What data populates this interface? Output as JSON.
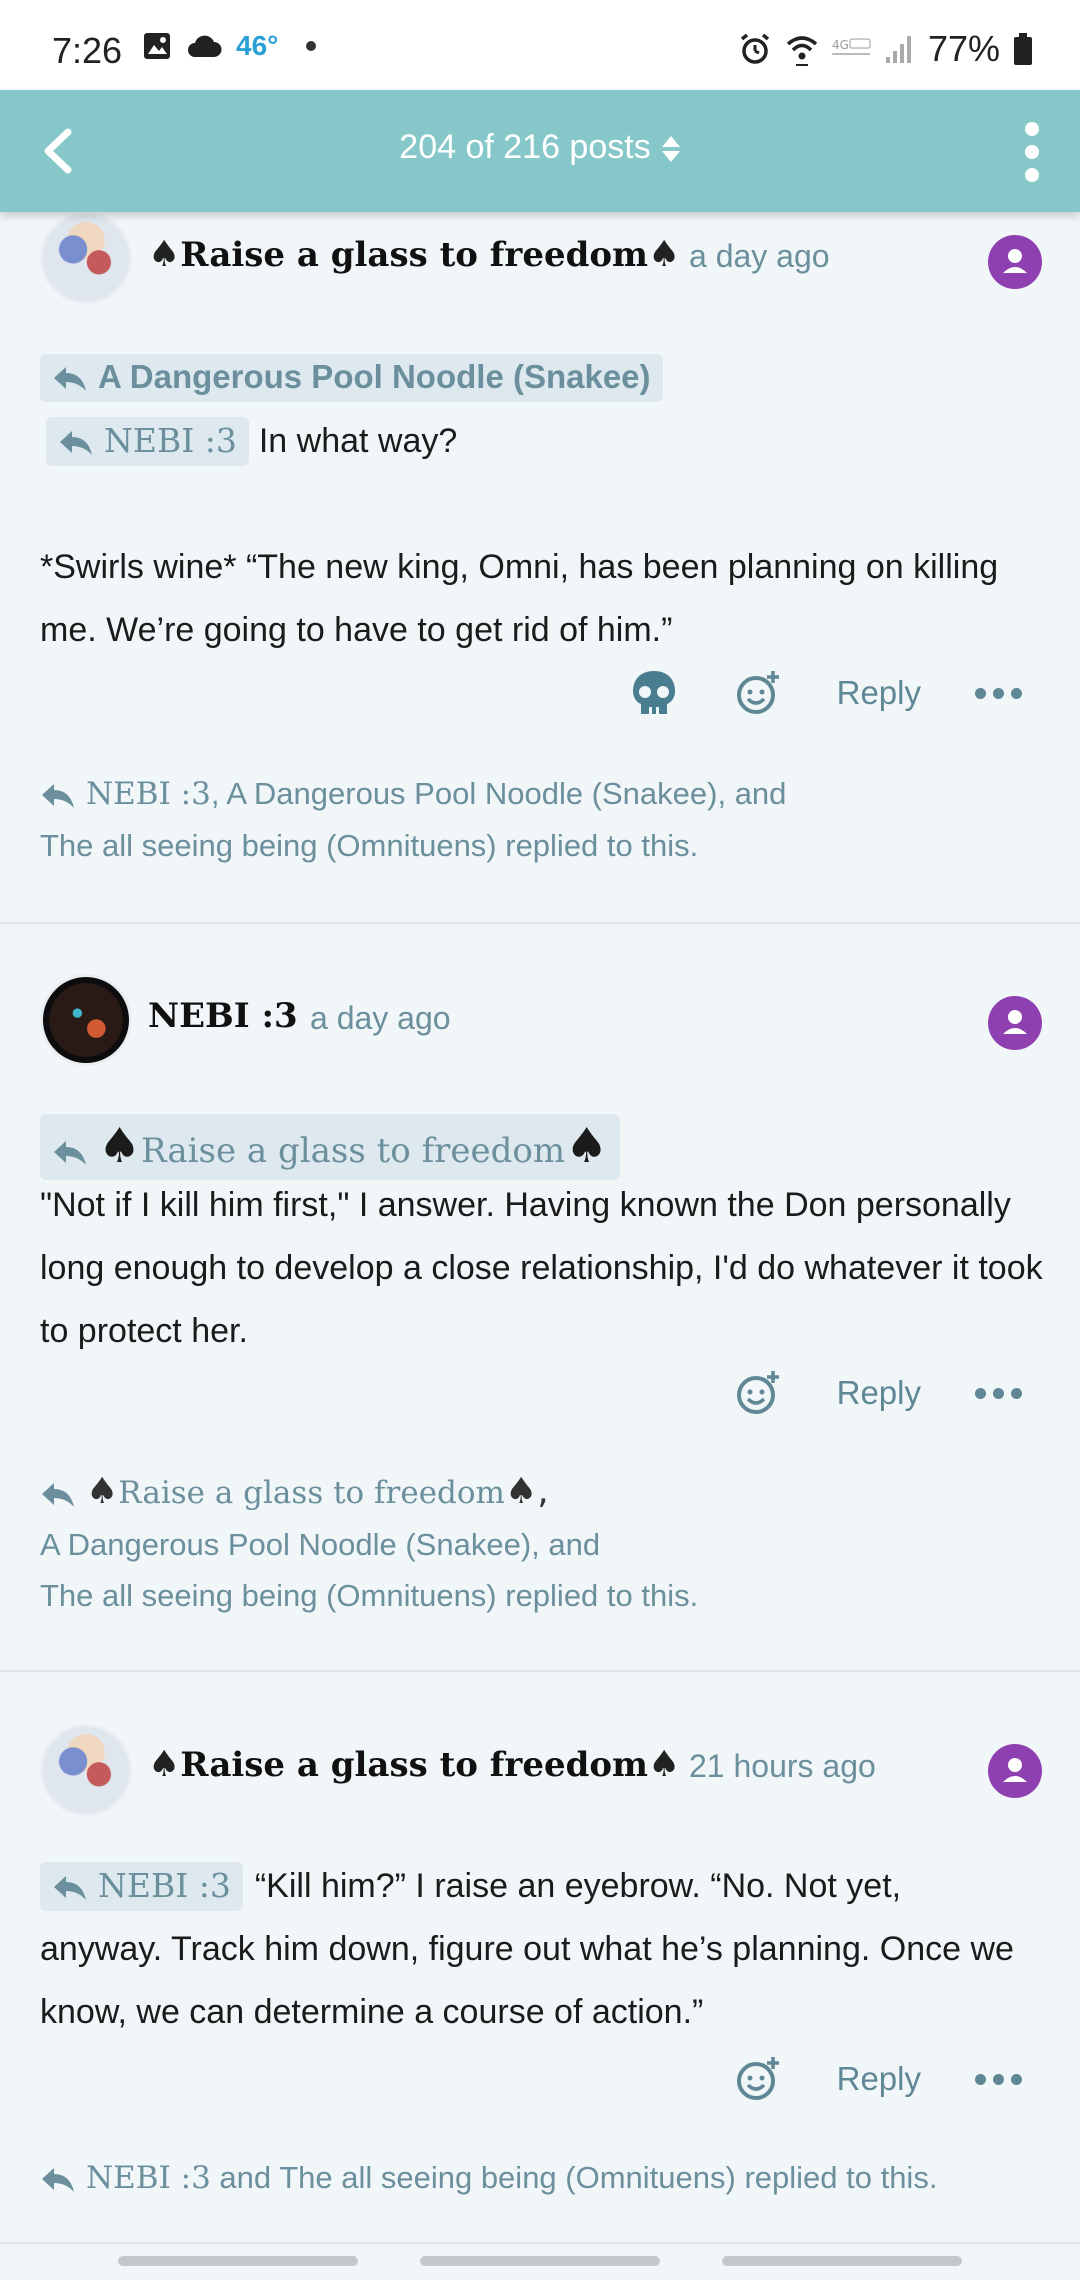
{
  "status_bar": {
    "time": "7:26",
    "temperature": "46°",
    "battery_percent": "77%"
  },
  "header": {
    "title": "204 of 216 posts"
  },
  "posts": [
    {
      "author": "Raise a glass to freedom",
      "author_prefix": "♠",
      "author_suffix": "♠",
      "time": "a day ago",
      "reply_to_1": "A Dangerous Pool Noodle (Snakee)",
      "reply_to_2": "NEBI :3",
      "line1": "In what way?",
      "body": "*Swirls wine* “The new king, Omni, has been planning on killing me. We’re going to have to get rid of him.”",
      "reply_label": "Reply",
      "replied_names_1": "NEBI :3",
      "replied_names_2": ", A Dangerous Pool Noodle (Snakee), and",
      "replied_names_3": "The all seeing being (Omnituens) replied to this."
    },
    {
      "author": "NEBI :3",
      "time": "a day ago",
      "reply_to_prefix": "♠",
      "reply_to": "Raise a glass to freedom",
      "reply_to_suffix": "♠",
      "body": "\"Not if I kill him first,\" I answer. Having known the Don personally long enough to develop a close relationship, I'd do whatever it took to protect her.",
      "reply_label": "Reply",
      "replied_names_1_prefix": "♠",
      "replied_names_1": "Raise a glass to freedom",
      "replied_names_1_suffix": "♠,",
      "replied_names_2": "A Dangerous Pool Noodle (Snakee), and",
      "replied_names_3": "The all seeing being (Omnituens) replied to this."
    },
    {
      "author": "Raise a glass to freedom",
      "author_prefix": "♠",
      "author_suffix": "♠",
      "time": "21 hours ago",
      "reply_to": "NEBI :3",
      "body_line1": "“Kill him?” I raise an eyebrow. “No. Not yet,",
      "body_rest": "anyway. Track him down, figure out what he’s planning. Once we know, we can determine a course of action.”",
      "reply_label": "Reply",
      "replied_names_1": "NEBI :3",
      "replied_names_2": " and The all seeing being (Omnituens) replied to this."
    }
  ],
  "colors": {
    "header_bg": "#86c8c9",
    "page_bg": "#f1f6f8",
    "profile_button": "#8e3fb0",
    "muted_text": "#6b8f9c"
  }
}
